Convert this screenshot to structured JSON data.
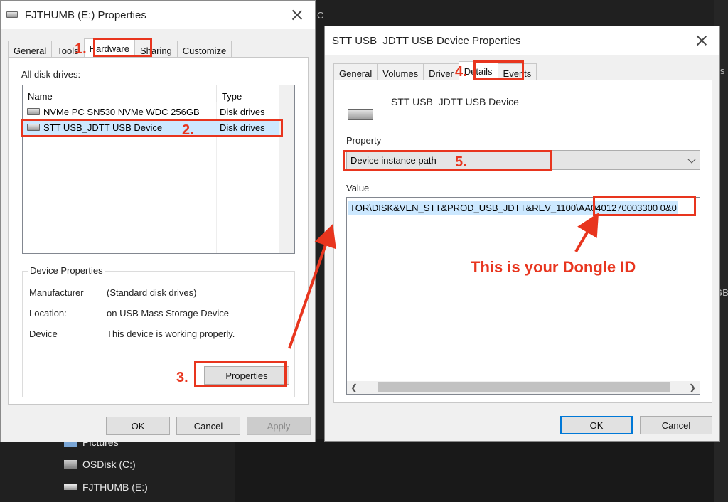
{
  "background": {
    "nav_items": [
      {
        "label": "Pictures"
      },
      {
        "label": "OSDisk (C:)"
      },
      {
        "label": "FJTHUMB (E:)"
      }
    ],
    "edge_fragments": [
      "C",
      "is",
      "GB"
    ]
  },
  "left_window": {
    "title": "FJTHUMB (E:) Properties",
    "tabs": [
      "General",
      "Tools",
      "Hardware",
      "Sharing",
      "Customize"
    ],
    "active_tab": "Hardware",
    "list_label": "All disk drives:",
    "columns": [
      "Name",
      "Type"
    ],
    "drives": [
      {
        "name": "NVMe PC SN530 NVMe WDC 256GB",
        "type": "Disk drives"
      },
      {
        "name": "STT USB_JDTT USB Device",
        "type": "Disk drives"
      }
    ],
    "device_properties": {
      "label": "Device Properties",
      "manufacturer_key": "Manufacturer",
      "manufacturer_value": "(Standard disk drives)",
      "location_key": "Location:",
      "location_value": "on USB Mass Storage Device",
      "status_key": "Device",
      "status_value": "This device is working properly."
    },
    "properties_button": "Properties",
    "buttons": {
      "ok": "OK",
      "cancel": "Cancel",
      "apply": "Apply"
    }
  },
  "right_window": {
    "title": "STT USB_JDTT USB Device Properties",
    "tabs": [
      "General",
      "Volumes",
      "Driver",
      "Details",
      "Events"
    ],
    "active_tab": "Details",
    "device_name": "STT USB_JDTT USB Device",
    "property_label": "Property",
    "property_selected": "Device instance path",
    "value_label": "Value",
    "value_text_left": "TOR\\DISK&VEN_STT&PROD_USB_JDTT&REV_1100",
    "value_text_right": "\\AA0401270003300 0&0",
    "buttons": {
      "ok": "OK",
      "cancel": "Cancel"
    }
  },
  "annotations": {
    "step1": "1.",
    "step2": "2.",
    "step3": "3.",
    "step4": "4.",
    "step5": "5.",
    "callout": "This is your Dongle ID",
    "color": "#e8351e"
  }
}
